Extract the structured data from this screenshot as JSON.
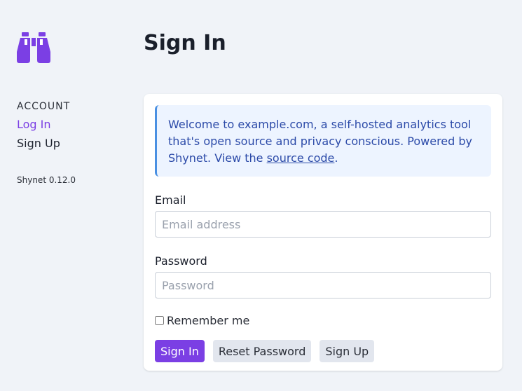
{
  "colors": {
    "accent": "#7b3fe4",
    "background": "#f0f3f8",
    "notice_bg": "#edf4ff",
    "notice_border": "#4a90e2",
    "notice_text": "#2b4aa8"
  },
  "sidebar": {
    "logo_icon": "binoculars-icon",
    "section_title": "ACCOUNT",
    "items": [
      {
        "label": "Log In",
        "active": true
      },
      {
        "label": "Sign Up",
        "active": false
      }
    ],
    "version": "Shynet 0.12.0"
  },
  "main": {
    "title": "Sign In",
    "notice": {
      "text_before": "Welcome to example.com, a self-hosted analytics tool that's open source and privacy conscious. Powered by Shynet. View the ",
      "link_text": "source code",
      "text_after": "."
    },
    "form": {
      "email_label": "Email",
      "email_placeholder": "Email address",
      "email_value": "",
      "password_label": "Password",
      "password_placeholder": "Password",
      "password_value": "",
      "remember_label": "Remember me",
      "remember_checked": false,
      "buttons": {
        "sign_in": "Sign In",
        "reset_password": "Reset Password",
        "sign_up": "Sign Up"
      }
    }
  }
}
